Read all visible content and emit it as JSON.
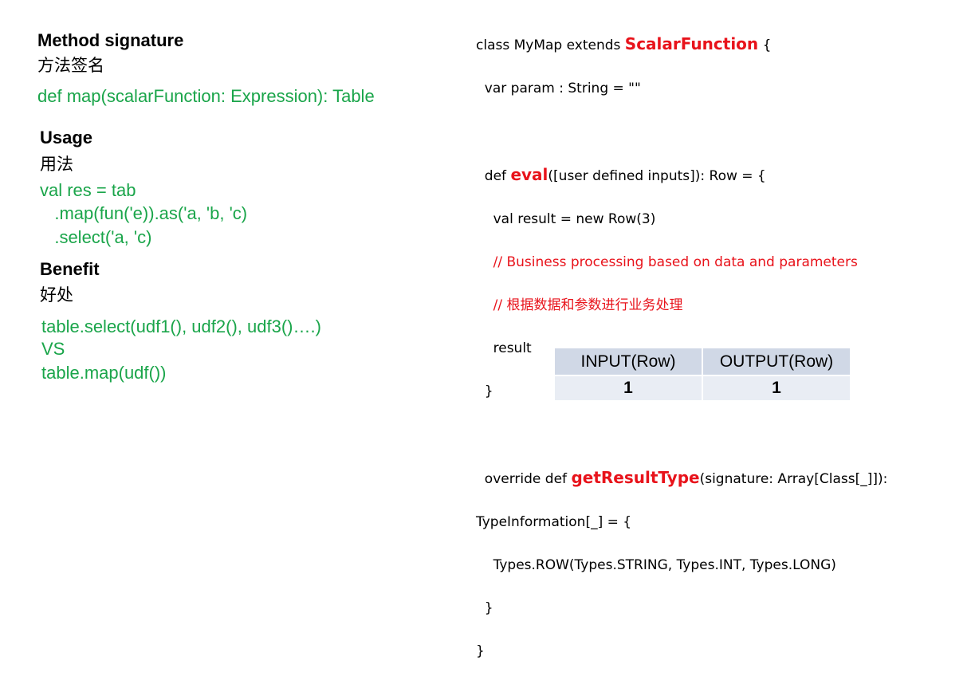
{
  "left": {
    "method_heading": "Method signature",
    "method_heading_cn": "方法签名",
    "method_signature": "def map(scalarFunction: Expression): Table",
    "usage_heading": "Usage",
    "usage_heading_cn": "用法",
    "usage_lines": [
      "val res = tab",
      "   .map(fun('e)).as('a, 'b, 'c)",
      "   .select('a, 'c)"
    ],
    "benefit_heading": "Benefit",
    "benefit_heading_cn": "好处",
    "benefit_lines": [
      "table.select(udf1(), udf2(), udf3()….)",
      "VS",
      "table.map(udf())"
    ]
  },
  "code": {
    "l1_pre": "class MyMap extends ",
    "l1_kw": "ScalarFunction",
    "l1_post": " {",
    "l2": "  var param : String = \"\"",
    "l4_pre": "  def ",
    "l4_kw": "eval",
    "l4_post": "([user defined inputs]): Row = {",
    "l5": "    val result = new Row(3)",
    "l6": "    // Business processing based on data and parameters",
    "l7": "    // 根据数据和参数进行业务处理",
    "l8": "    result",
    "l9": "  }",
    "l11_pre": "  override def ",
    "l11_kw": "getResultType",
    "l11_post": "(signature: Array[Class[_]]):",
    "l12": "TypeInformation[_] = {",
    "l13": "    Types.ROW(Types.STRING, Types.INT, Types.LONG)",
    "l14": "  }",
    "l15": "}"
  },
  "io_table": {
    "headers": [
      "INPUT(Row)",
      "OUTPUT(Row)"
    ],
    "row": [
      "1",
      "1"
    ]
  },
  "colors": {
    "green": "#1aa54a",
    "red": "#e8131b",
    "header_bg": "#d0d8e6",
    "cell_bg": "#e9edf4"
  }
}
